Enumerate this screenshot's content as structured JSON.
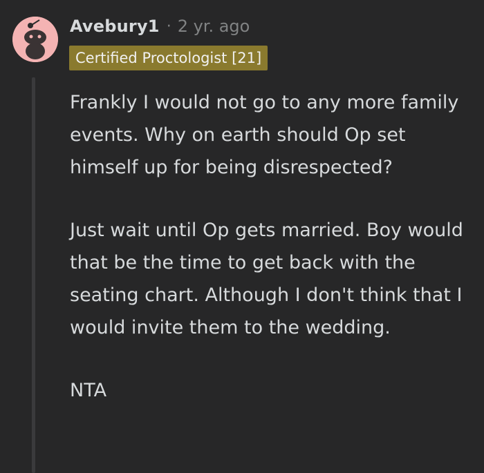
{
  "comment": {
    "author": "Avebury1",
    "separator": "·",
    "timestamp": "2 yr. ago",
    "flair": "Certified Proctologist [21]",
    "paragraphs": [
      "Frankly I would not go to any more family events. Why on earth should Op set himself up for being disrespected?",
      "Just wait until Op gets married. Boy would that be the time to get back with the seating chart. Although I don't think that I would invite them to the wedding.",
      "NTA"
    ]
  },
  "colors": {
    "background": "#272728",
    "text": "#d7dadc",
    "muted": "#818384",
    "flair_background": "#8a7a2e",
    "avatar_background": "#f4b3b3",
    "thread_line": "#3a3a3c"
  },
  "icons": {
    "avatar": "reddit-snoo-avatar-icon"
  }
}
